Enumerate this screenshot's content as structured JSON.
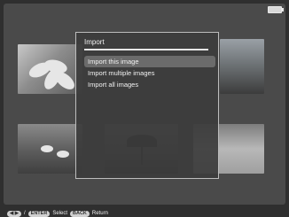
{
  "dialog": {
    "title": "Import",
    "items": [
      {
        "label": "Import this image",
        "selected": true
      },
      {
        "label": "Import multiple images",
        "selected": false
      },
      {
        "label": "Import all images",
        "selected": false
      }
    ]
  },
  "footer": {
    "nav_label": "◀ ▶",
    "separator": "/",
    "enter_key": "ENTER",
    "select_label": "Select",
    "back_key": "BACK",
    "return_label": "Return"
  },
  "colors": {
    "background": "#2f2f2f",
    "dialog": "#3c3c3c",
    "highlight": "#6b6b6b",
    "text": "#f1f1f1"
  },
  "icons": {
    "battery": "battery-icon"
  }
}
